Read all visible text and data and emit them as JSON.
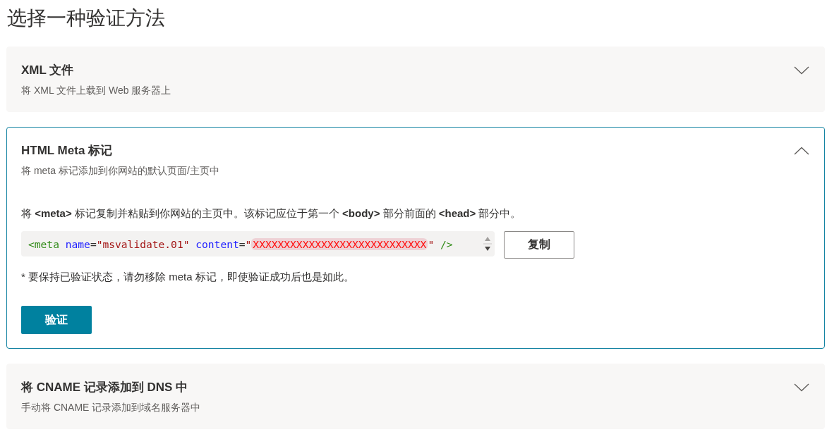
{
  "heading": "选择一种验证方法",
  "methods": [
    {
      "title": "XML 文件",
      "subtitle": "将 XML 文件上载到 Web 服务器上",
      "expanded": false
    },
    {
      "title": "HTML Meta 标记",
      "subtitle": "将 meta 标记添加到你网站的默认页面/主页中",
      "expanded": true,
      "instructions": "将 **<meta>** 标记复制并粘贴到你网站的主页中。该标记应位于第一个 **<body>** 部分前面的 **<head>** 部分中。",
      "code": [
        {
          "kind": "tag",
          "text": "<meta"
        },
        {
          "kind": "attr",
          "text": " name"
        },
        {
          "kind": "punct",
          "text": "="
        },
        {
          "kind": "value",
          "text": "\"msvalidate.01\""
        },
        {
          "kind": "attr",
          "text": " content"
        },
        {
          "kind": "punct",
          "text": "="
        },
        {
          "kind": "value",
          "text": "\""
        },
        {
          "kind": "redacted",
          "text": "XXXXXXXXXXXXXXXXXXXXXXXXXXXX"
        },
        {
          "kind": "value",
          "text": "\""
        },
        {
          "kind": "tag",
          "text": " />"
        }
      ],
      "copy_button": "复制",
      "note": "* 要保持已验证状态，请勿移除 meta 标记，即使验证成功后也是如此。",
      "verify_button": "验证"
    },
    {
      "title": "将 CNAME 记录添加到 DNS 中",
      "subtitle": "手动将 CNAME 记录添加到域名服务器中",
      "expanded": false
    }
  ]
}
